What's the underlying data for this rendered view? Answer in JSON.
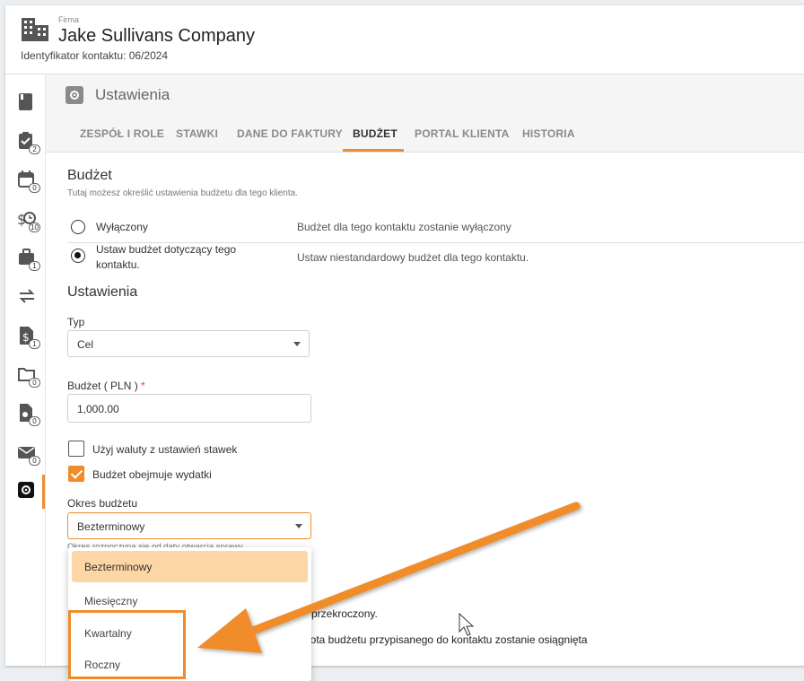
{
  "header": {
    "company_label": "Firma",
    "company_name": "Jake Sullivans Company",
    "contact_id": "Identyfikator kontaktu: 06/2024"
  },
  "sidebar": {
    "items": [
      {
        "icon": "book-icon",
        "badge": ""
      },
      {
        "icon": "clipboard-check-icon",
        "badge": "2"
      },
      {
        "icon": "calendar-icon",
        "badge": "0"
      },
      {
        "icon": "time-money-icon",
        "badge": "10"
      },
      {
        "icon": "briefcase-icon",
        "badge": "1"
      },
      {
        "icon": "transfer-icon",
        "badge": ""
      },
      {
        "icon": "invoice-icon",
        "badge": "1"
      },
      {
        "icon": "folder-icon",
        "badge": "0"
      },
      {
        "icon": "file-clock-icon",
        "badge": "0"
      },
      {
        "icon": "mail-icon",
        "badge": "0"
      },
      {
        "icon": "gear-icon",
        "badge": ""
      }
    ]
  },
  "settings": {
    "title": "Ustawienia"
  },
  "tabs": [
    "ZESPÓŁ I ROLE",
    "STAWKI",
    "DANE DO FAKTURY",
    "BUDŻET",
    "PORTAL KLIENTA",
    "HISTORIA"
  ],
  "budget": {
    "title": "Budżet",
    "desc": "Tutaj możesz określić ustawienia budżetu dla tego klienta.",
    "opt_off_label": "Wyłączony",
    "opt_off_desc": "Budżet dla tego kontaktu zostanie wyłączony",
    "opt_on_label_1": "Ustaw budżet dotyczący tego",
    "opt_on_label_2": "kontaktu.",
    "opt_on_desc": "Ustaw niestandardowy budżet dla tego kontaktu."
  },
  "form": {
    "section_title": "Ustawienia",
    "type_label": "Typ",
    "type_value": "Cel",
    "amount_label": "Budżet ( PLN )",
    "amount_required": "*",
    "amount_value": "1,000.00",
    "cb_currency": "Użyj waluty z ustawień stawek",
    "cb_expenses": "Budżet obejmuje wydatki",
    "period_label": "Okres budżetu",
    "period_value": "Bezterminowy",
    "period_hint": "Okres rozpoczyna się od daty otwarcia sprawy.",
    "bg_text_1": "e przekroczony.",
    "bg_text_2": "wota budżetu przypisanego do kontaktu zostanie osiągnięta"
  },
  "dropdown": {
    "options": [
      "Bezterminowy",
      "Miesięczny",
      "Kwartalny",
      "Roczny"
    ]
  },
  "colors": {
    "accent": "#f08c2a",
    "selected_option_bg": "#fdd6a5"
  }
}
